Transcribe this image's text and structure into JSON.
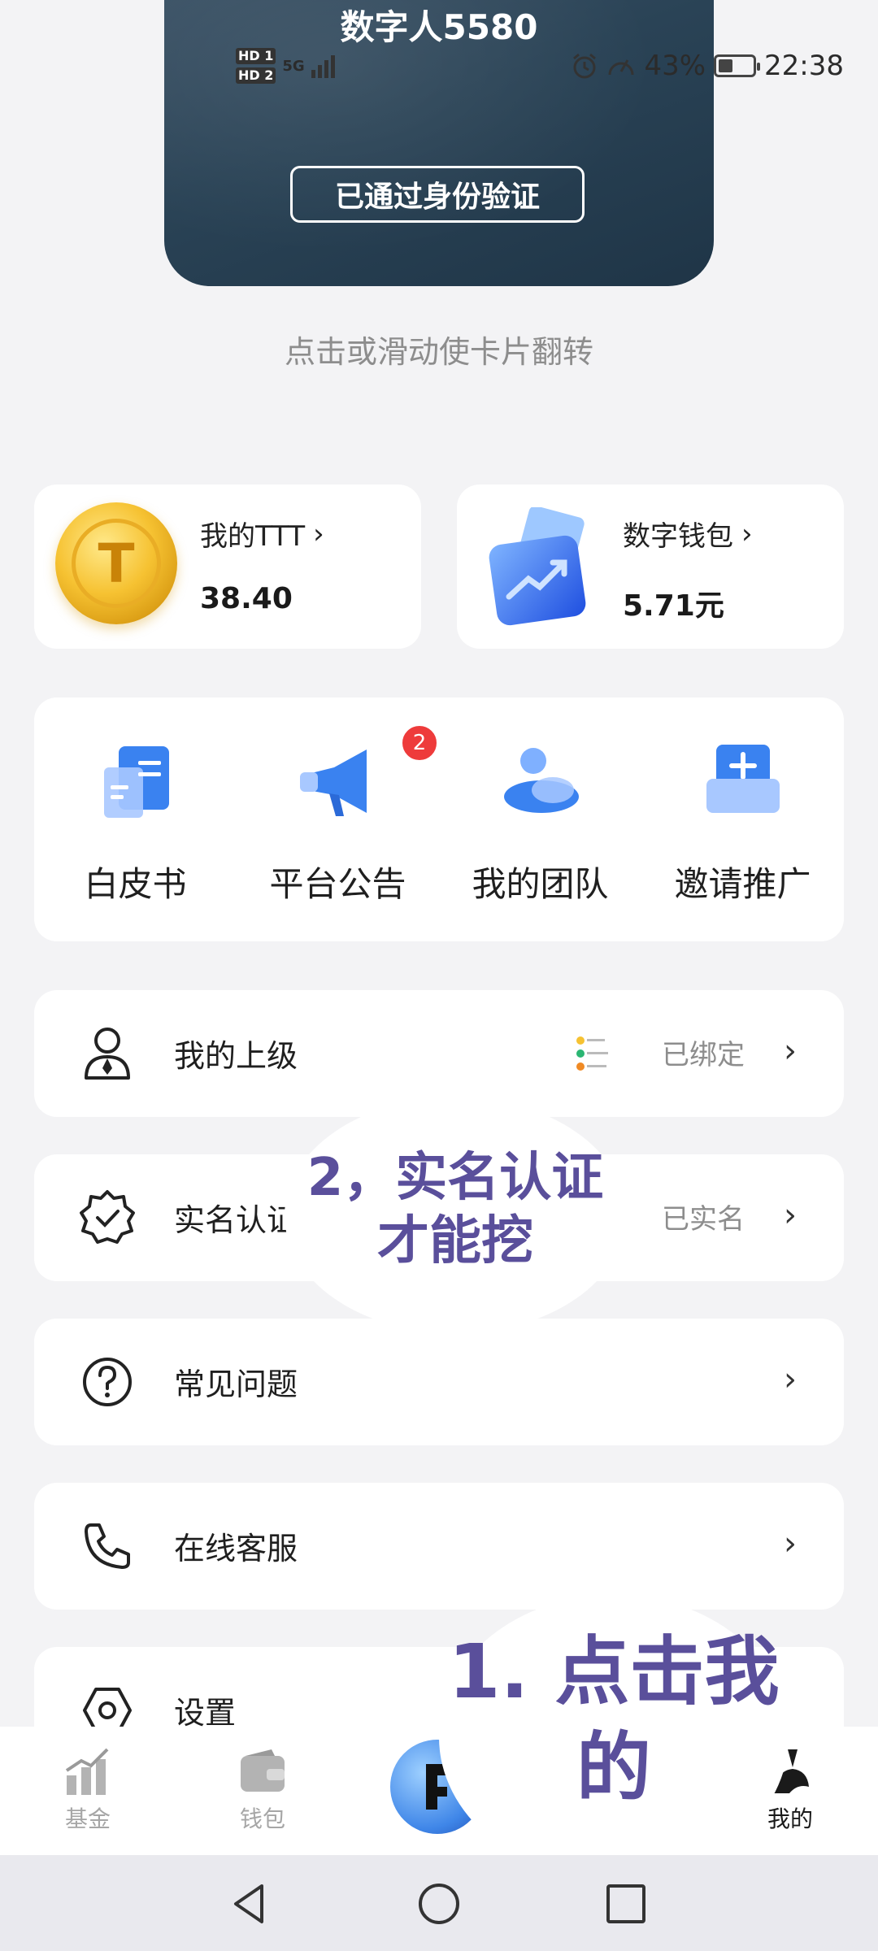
{
  "status_bar": {
    "battery_percent": "43%",
    "time": "22:38",
    "network": "5G",
    "battery_level": 0.43
  },
  "id_card": {
    "name": "数字人5580",
    "verify_label": "已通过身份验证"
  },
  "flip_hint": "点击或滑动使卡片翻转",
  "assets": [
    {
      "title": "我的TTT",
      "value": "38.40",
      "coin_letter": "T",
      "icon": "ttt-coin-icon"
    },
    {
      "title": "数字钱包",
      "value": "5.71元",
      "icon": "digital-wallet-icon"
    }
  ],
  "quick_actions": [
    {
      "label": "白皮书",
      "icon": "whitepaper-icon"
    },
    {
      "label": "平台公告",
      "icon": "megaphone-icon",
      "badge": "2"
    },
    {
      "label": "我的团队",
      "icon": "team-icon"
    },
    {
      "label": "邀请推广",
      "icon": "invite-icon"
    }
  ],
  "list": [
    {
      "label": "我的上级",
      "status": "已绑定",
      "icon": "user-tie-icon"
    },
    {
      "label": "实名认证",
      "status": "已实名",
      "icon": "verified-badge-icon"
    },
    {
      "label": "常见问题",
      "status": "",
      "icon": "question-icon"
    },
    {
      "label": "在线客服",
      "status": "",
      "icon": "phone-icon"
    },
    {
      "label": "设置",
      "status": "",
      "icon": "settings-hex-icon"
    }
  ],
  "annotations": {
    "step2": "2，实名认证才能挖",
    "step1": "1.  点击我的"
  },
  "tabs": [
    {
      "label": "基金",
      "icon": "chart-icon",
      "active": false
    },
    {
      "label": "钱包",
      "icon": "wallet-icon",
      "active": false
    },
    {
      "label": "",
      "icon": "center-logo-icon",
      "active": false
    },
    {
      "label": "我的",
      "icon": "profile-icon",
      "active": true
    }
  ],
  "nav": {
    "back": "back-icon",
    "home": "home-icon",
    "recent": "recent-icon"
  },
  "colors": {
    "accent_blue": "#3f86e8",
    "badge_red": "#ee3b3b",
    "annotation_purple": "#5a4f9b",
    "coin_gold": "#f6c232"
  }
}
